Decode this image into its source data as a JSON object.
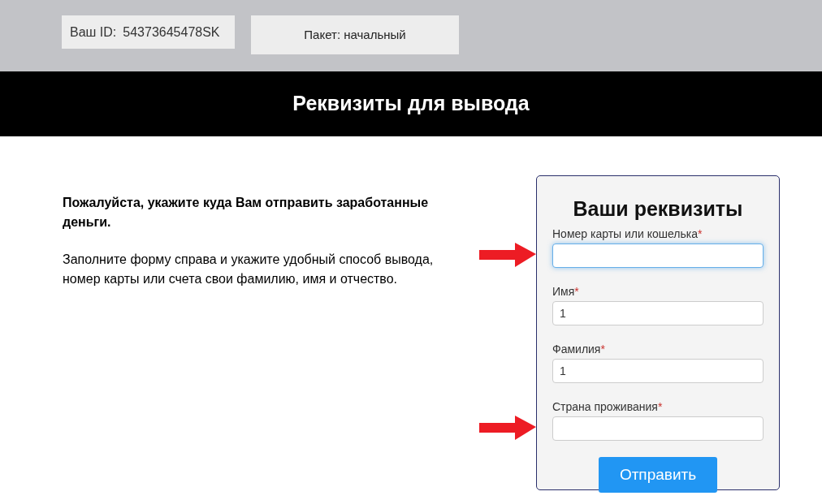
{
  "header": {
    "id_label": "Ваш ID:",
    "id_value": "54373645478SK",
    "package": "Пакет: начальный"
  },
  "banner": {
    "title": "Реквизиты для вывода"
  },
  "intro": {
    "lead": "Пожалуйста, укажите куда Вам отправить заработанные деньги.",
    "text": "Заполните форму справа и укажите удобный способ вывода, номер карты или счета свои фамилию, имя и отчество."
  },
  "form": {
    "title": "Ваши реквизиты",
    "fields": [
      {
        "label": "Номер карты или кошелька",
        "required_mark": "*",
        "focused": true,
        "arrow": true
      },
      {
        "label": "Имя",
        "required_mark": "*",
        "value": "1",
        "focused": false,
        "arrow": false
      },
      {
        "label": "Фамилия",
        "required_mark": "*",
        "value": "1",
        "focused": false,
        "arrow": false
      },
      {
        "label": "Страна проживания",
        "required_mark": "*",
        "focused": false,
        "arrow": true
      }
    ],
    "submit": "Отправить"
  }
}
